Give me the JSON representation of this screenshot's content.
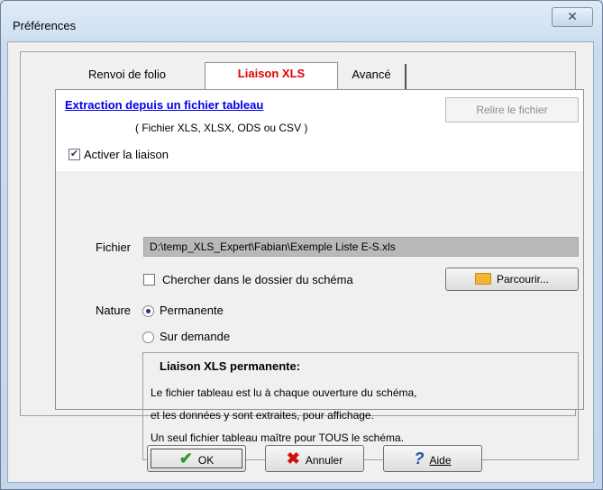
{
  "window": {
    "title": "Préférences",
    "close_glyph": "✕"
  },
  "tabs": [
    {
      "label": "Renvoi de folio",
      "active": false
    },
    {
      "label": "Liaison XLS",
      "active": true
    },
    {
      "label": "Avancé",
      "active": false
    }
  ],
  "xls": {
    "section_title": "Extraction depuis un fichier tableau",
    "formats_note": "( Fichier XLS, XLSX, ODS ou CSV )",
    "reload_button": "Relire le fichier",
    "enable_checkbox": {
      "label": "Activer la liaison",
      "checked": true
    },
    "file_label": "Fichier",
    "file_path": "D:\\temp_XLS_Expert\\Fabian\\Exemple Liste E-S.xls",
    "search_schema_checkbox": {
      "label": "Chercher dans le dossier du schéma",
      "checked": false
    },
    "browse_button": "Parcourir...",
    "nature_label": "Nature",
    "nature_options": [
      {
        "label": "Permanente",
        "selected": true
      },
      {
        "label": "Sur demande",
        "selected": false
      }
    ],
    "info": {
      "title": "Liaison XLS permanente:",
      "lines": [
        "Le fichier tableau est lu à chaque ouverture du schéma,",
        "et les données y sont extraites, pour affichage.",
        "Un seul fichier tableau maître pour TOUS le schéma."
      ]
    }
  },
  "footer": {
    "ok": "OK",
    "cancel": "Annuler",
    "help": "Aide"
  },
  "colors": {
    "active_tab_text": "#e20000",
    "link": "#0000ee",
    "ok_check": "#2e9a2e",
    "cancel_x": "#d01010",
    "help_q": "#1f4fb0",
    "folder": "#f2b634"
  },
  "icons": {
    "ok": "checkmark-icon",
    "cancel": "x-icon",
    "help": "question-icon",
    "browse": "folder-icon",
    "close": "close-icon"
  }
}
